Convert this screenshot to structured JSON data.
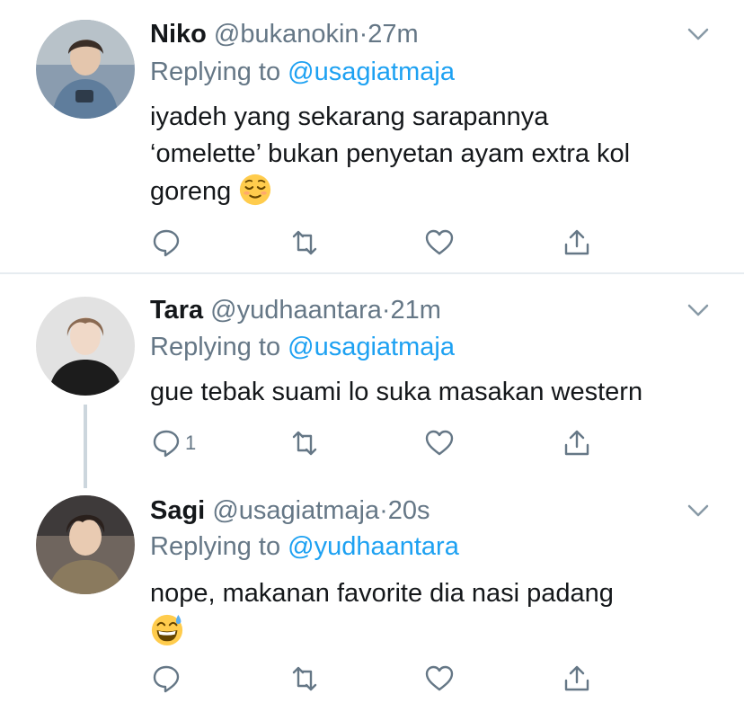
{
  "tweets": [
    {
      "name": "Niko",
      "handle": "@bukanokin",
      "time": "27m",
      "replying_label": "Replying to",
      "replying_to": "@usagiatmaja",
      "text_lines": [
        "iyadeh yang sekarang sarapannya",
        "‘omelette’ bukan penyetan ayam extra kol",
        "goreng"
      ],
      "emoji": "relieved-face",
      "reply_count": "",
      "avatar_bg": "#8fa3b8"
    },
    {
      "name": "Tara",
      "handle": "@yudhaantara",
      "time": "21m",
      "replying_label": "Replying to",
      "replying_to": "@usagiatmaja",
      "text_lines": [
        "gue tebak suami lo suka masakan western"
      ],
      "reply_count": "1",
      "avatar_bg": "#d9d9d9"
    },
    {
      "name": "Sagi",
      "handle": "@usagiatmaja",
      "time": "20s",
      "replying_label": "Replying to",
      "replying_to": "@yudhaantara",
      "text_lines": [
        "nope, makanan favorite dia nasi padang"
      ],
      "emoji": "grinning-face-with-sweat",
      "reply_count": "",
      "avatar_bg": "#7a7068"
    }
  ],
  "separator": "·",
  "icons": {
    "reply": "reply-icon",
    "retweet": "retweet-icon",
    "like": "like-icon",
    "share": "share-icon",
    "more": "chevron-down-icon"
  },
  "colors": {
    "text": "#14171a",
    "secondary": "#657786",
    "mention": "#1da1f2",
    "divider": "#e6ecf0"
  }
}
